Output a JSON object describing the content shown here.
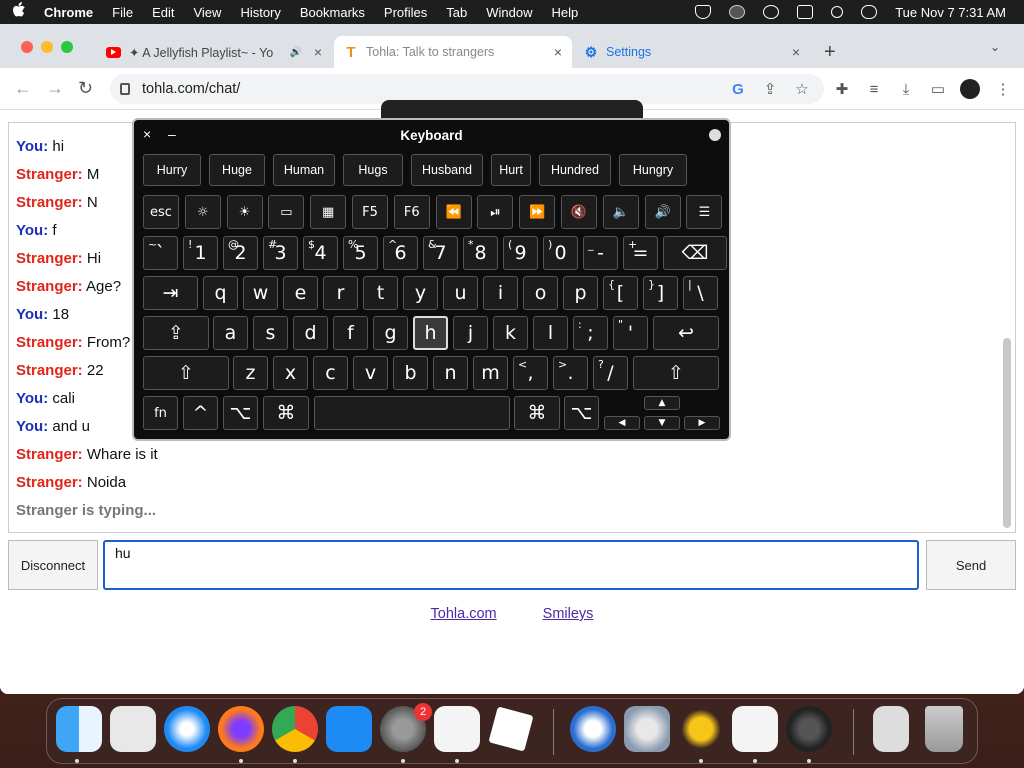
{
  "menubar": {
    "apple": "",
    "app": "Chrome",
    "items": [
      "File",
      "Edit",
      "View",
      "History",
      "Bookmarks",
      "Profiles",
      "Tab",
      "Window",
      "Help"
    ],
    "clock": "Tue Nov 7  7:31 AM"
  },
  "tabs": [
    {
      "label": "✦ A Jellyfish Playlist~ - Yo",
      "icon": "youtube-icon",
      "audio": "🔊"
    },
    {
      "label": "Tohla: Talk to strangers",
      "icon": "tohla-icon",
      "fav": "T"
    },
    {
      "label": "Settings",
      "icon": "gear-icon",
      "fav": "⚙"
    }
  ],
  "tab_close": "×",
  "new_tab": "+",
  "tab_menu": "⌄",
  "toolbar": {
    "back": "←",
    "forward": "→",
    "reload": "↻",
    "url": "tohla.com/chat/"
  },
  "chat": {
    "messages": [
      {
        "who": "You:",
        "kind": "you",
        "text": "hi"
      },
      {
        "who": "Stranger:",
        "kind": "stranger",
        "text": "M"
      },
      {
        "who": "Stranger:",
        "kind": "stranger",
        "text": "N"
      },
      {
        "who": "You:",
        "kind": "you",
        "text": "f"
      },
      {
        "who": "Stranger:",
        "kind": "stranger",
        "text": "Hi"
      },
      {
        "who": "Stranger:",
        "kind": "stranger",
        "text": "Age?"
      },
      {
        "who": "You:",
        "kind": "you",
        "text": "18"
      },
      {
        "who": "Stranger:",
        "kind": "stranger",
        "text": "From?"
      },
      {
        "who": "Stranger:",
        "kind": "stranger",
        "text": "22"
      },
      {
        "who": "You:",
        "kind": "you",
        "text": "cali"
      },
      {
        "who": "You:",
        "kind": "you",
        "text": "and u"
      },
      {
        "who": "Stranger:",
        "kind": "stranger",
        "text": "Whare is it"
      },
      {
        "who": "Stranger:",
        "kind": "stranger",
        "text": "Noida"
      }
    ],
    "typing": "Stranger is typing...",
    "input_value": "hu",
    "disconnect_label": "Disconnect",
    "send_label": "Send"
  },
  "footer": {
    "link1": "Tohla.com",
    "link2": "Smileys"
  },
  "keyboard": {
    "title": "Keyboard",
    "close": "×",
    "minimize": "–",
    "suggestions": [
      "Hurry",
      "Huge",
      "Human",
      "Hugs",
      "Husband",
      "Hurt",
      "Hundred",
      "Hungry"
    ],
    "fn_row": [
      "esc",
      "☼",
      "☀",
      "▭",
      "▦",
      "F5",
      "F6",
      "⏪",
      "⏯",
      "⏩",
      "🔇",
      "🔈",
      "🔊",
      "☰"
    ],
    "num_row": [
      [
        "`",
        "~"
      ],
      [
        "1",
        "!"
      ],
      [
        "2",
        "@"
      ],
      [
        "3",
        "#"
      ],
      [
        "4",
        "$"
      ],
      [
        "5",
        "%"
      ],
      [
        "6",
        "^"
      ],
      [
        "7",
        "&"
      ],
      [
        "8",
        "*"
      ],
      [
        "9",
        "("
      ],
      [
        "0",
        ")"
      ],
      [
        "-",
        "_"
      ],
      [
        "=",
        "+"
      ]
    ],
    "row_q": [
      "q",
      "w",
      "e",
      "r",
      "t",
      "y",
      "u",
      "i",
      "o",
      "p",
      [
        "[",
        "{"
      ],
      [
        "]",
        "}"
      ],
      [
        "\\",
        "|"
      ]
    ],
    "row_a": [
      "a",
      "s",
      "d",
      "f",
      "g",
      "h",
      "j",
      "k",
      "l",
      [
        ";",
        ":"
      ],
      [
        "'",
        "\""
      ]
    ],
    "row_z": [
      "z",
      "x",
      "c",
      "v",
      "b",
      "n",
      "m",
      [
        ",",
        "<"
      ],
      [
        ".",
        ">"
      ],
      [
        "/",
        "?"
      ]
    ],
    "tab": "⇥",
    "caps": "⇪",
    "delete": "⌫",
    "return": "↩",
    "shift": "⇧",
    "fn": "fn",
    "ctrl": "^",
    "opt": "⌥",
    "cmd": "⌘",
    "arrow_left": "◀",
    "arrow_right": "▶",
    "arrow_up": "▲",
    "arrow_down": "▼",
    "pressed": "h"
  },
  "dock": {
    "badge": "2"
  },
  "colors": {
    "you": "#1a2fb8",
    "stranger": "#e0251b",
    "link": "#4a2aa8",
    "accent": "#1a5fd0"
  }
}
